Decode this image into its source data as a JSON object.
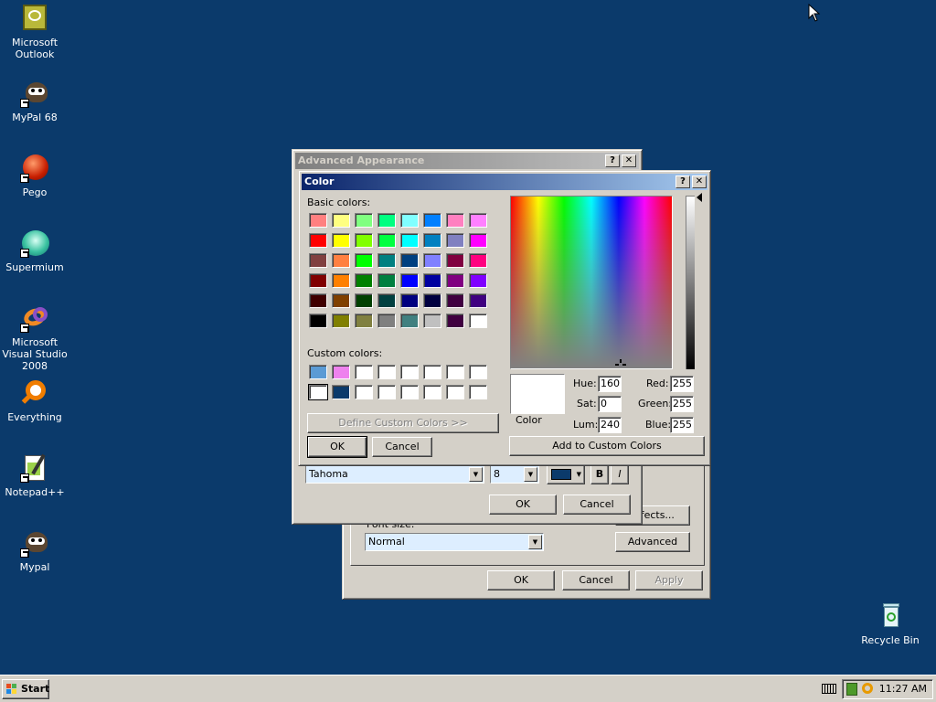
{
  "desktop": {
    "icons": [
      {
        "label": "Microsoft Outlook",
        "icon": "outlook-icon"
      },
      {
        "label": "MyPal 68",
        "icon": "mypal-icon"
      },
      {
        "label": "Pego",
        "icon": "pego-icon"
      },
      {
        "label": "Supermium",
        "icon": "supermium-icon"
      },
      {
        "label": "Microsoft Visual Studio 2008",
        "icon": "visual-studio-icon"
      },
      {
        "label": "Everything",
        "icon": "everything-icon"
      },
      {
        "label": "Notepad++",
        "icon": "notepadpp-icon"
      },
      {
        "label": "Mypal",
        "icon": "mypal-icon"
      },
      {
        "label": "Recycle Bin",
        "icon": "recycle-bin-icon"
      }
    ],
    "background_color": "#0b3a6b"
  },
  "advanced_appearance": {
    "title": "Advanced Appearance",
    "help": "?",
    "close": "✕",
    "font_combo": "Tahoma",
    "size_combo": "8",
    "bold": "B",
    "italic": "I",
    "ok": "OK",
    "cancel": "Cancel"
  },
  "display_properties": {
    "effects_button": "Effects...",
    "font_size_label": "Font size:",
    "font_size_value": "Normal",
    "advanced_button": "Advanced",
    "ok": "OK",
    "cancel": "Cancel",
    "apply": "Apply"
  },
  "color_dialog": {
    "title": "Color",
    "help": "?",
    "close": "✕",
    "basic_colors_label": "Basic colors:",
    "custom_colors_label": "Custom colors:",
    "define_custom_button": "Define Custom Colors >>",
    "ok": "OK",
    "cancel": "Cancel",
    "color_solid_label": "Color",
    "hue_label": "Hue:",
    "sat_label": "Sat:",
    "lum_label": "Lum:",
    "red_label": "Red:",
    "green_label": "Green:",
    "blue_label": "Blue:",
    "hue": "160",
    "sat": "0",
    "lum": "240",
    "red": "255",
    "green": "255",
    "blue": "255",
    "add_custom_button": "Add to Custom Colors",
    "basic_colors": [
      "#ff8080",
      "#ffff80",
      "#80ff80",
      "#00ff80",
      "#80ffff",
      "#0080ff",
      "#ff80c0",
      "#ff80ff",
      "#ff0000",
      "#ffff00",
      "#80ff00",
      "#00ff40",
      "#00ffff",
      "#0080c0",
      "#8080c0",
      "#ff00ff",
      "#804040",
      "#ff8040",
      "#00ff00",
      "#008080",
      "#004080",
      "#8080ff",
      "#800040",
      "#ff0080",
      "#800000",
      "#ff8000",
      "#008000",
      "#008040",
      "#0000ff",
      "#0000a0",
      "#800080",
      "#8000ff",
      "#400000",
      "#804000",
      "#004000",
      "#004040",
      "#000080",
      "#000040",
      "#400040",
      "#400080",
      "#000000",
      "#808000",
      "#808040",
      "#808080",
      "#408080",
      "#c0c0c0",
      "#400040",
      "#ffffff"
    ],
    "custom_colors": [
      "#5b9bd5",
      "#ee82ee",
      "#ffffff",
      "#ffffff",
      "#ffffff",
      "#ffffff",
      "#ffffff",
      "#ffffff",
      "#ffffff",
      "#0b3a6b",
      "#ffffff",
      "#ffffff",
      "#ffffff",
      "#ffffff",
      "#ffffff",
      "#ffffff"
    ],
    "selected_custom_index": 8
  },
  "taskbar": {
    "start_label": "Start",
    "clock": "11:27 AM"
  }
}
